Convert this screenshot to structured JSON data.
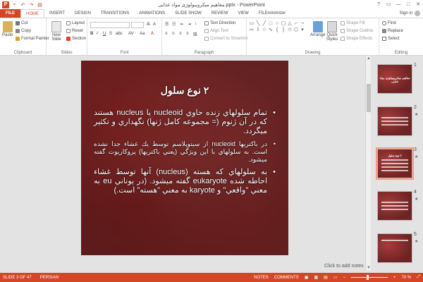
{
  "titlebar": {
    "title": "مفاهیم میکروبیولوژی مواد غذایی.pptx - PowerPoint",
    "app_icon": "P",
    "window_buttons": [
      "?",
      "▭",
      "—",
      "□",
      "✕"
    ]
  },
  "tabs": [
    "FILE",
    "HOME",
    "INSERT",
    "DESIGN",
    "TRANSITIONS",
    "ANIMATIONS",
    "SLIDE SHOW",
    "REVIEW",
    "VIEW",
    "FILEminimizer"
  ],
  "active_tab": "HOME",
  "signin": "Sign in",
  "ribbon": {
    "clipboard": {
      "label": "Clipboard",
      "paste": "Paste",
      "cut": "Cut",
      "copy": "Copy",
      "format_painter": "Format Painter"
    },
    "slides": {
      "label": "Slides",
      "new_slide": "New Slide",
      "layout": "Layout",
      "reset": "Reset",
      "section": "Section"
    },
    "font": {
      "label": "Font"
    },
    "paragraph": {
      "label": "Paragraph",
      "text_direction": "Text Direction",
      "align_text": "Align Text",
      "convert_smartart": "Convert to SmartArt"
    },
    "drawing": {
      "label": "Drawing",
      "arrange": "Arrange",
      "quick_styles": "Quick Styles",
      "shape_fill": "Shape Fill",
      "shape_outline": "Shape Outline",
      "shape_effects": "Shape Effects"
    },
    "editing": {
      "label": "Editing",
      "find": "Find",
      "replace": "Replace",
      "select": "Select"
    }
  },
  "slide": {
    "title": "۲ نوع سلول",
    "bullets": [
      "تمام سلولهاي زنده حاوي nucleoid يا nucleus هستند كه در آن ژنوم (= مجموعه كامل ژنها) نگهداري و تكثير ميگردد.",
      "در باكتريها nucleoid از سيتوپلاسم توسط يك غشاء جدا نشده است. به سلولهاي با اين ويژگي (يعني باكتريها) پروكاريوت گفته ميشود.",
      "به سلولهاي كه هسته (nucleus) آنها توسط غشاء احاطه شده eukaryote گفته ميشود. (در يوناني eu به معني \"واقعي\" و karyote به معني \"هسته\" است.)"
    ]
  },
  "notes_hint": "Click to add notes",
  "thumbnails": [
    {
      "num": "1",
      "title": "مفاهیم میکروبیولوژی مواد غذایی",
      "star": ""
    },
    {
      "num": "2",
      "title": "",
      "star": "★"
    },
    {
      "num": "3",
      "title": "۲ نوع سلول",
      "star": "★"
    },
    {
      "num": "4",
      "title": "",
      "star": "★"
    },
    {
      "num": "5",
      "title": "",
      "star": "★"
    }
  ],
  "status": {
    "slide": "SLIDE 3 OF 47",
    "language": "PERSIAN",
    "notes": "NOTES",
    "comments": "COMMENTS",
    "zoom": "70 %"
  }
}
